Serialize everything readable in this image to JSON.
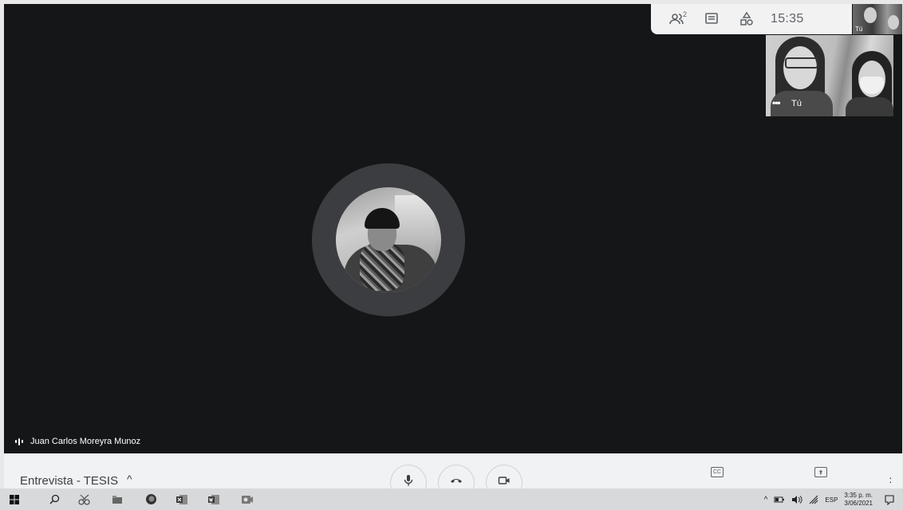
{
  "top_panel": {
    "people_count": "2",
    "clock": "15:35",
    "mini_self_label": "Tú",
    "icons": [
      "people-icon",
      "chat-icon",
      "activities-icon"
    ]
  },
  "self_tile": {
    "label": "Tú",
    "more": "•••"
  },
  "speaker": {
    "name": "Juan Carlos Moreyra Munoz"
  },
  "meeting": {
    "title": "Entrevista - TESIS",
    "chevron": "^"
  },
  "controls": [
    "microphone",
    "end-call",
    "camera",
    "captions",
    "present-now",
    "more-options"
  ],
  "taskbar": {
    "language": "ESP",
    "time": "3:35 p. m.",
    "date": "3/06/2021",
    "tray_chevron": "^"
  }
}
